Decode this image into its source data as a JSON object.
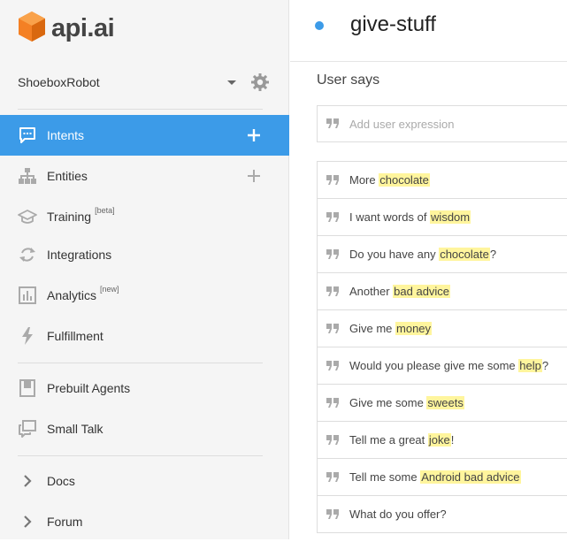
{
  "logo": {
    "text": "api.ai"
  },
  "agent": {
    "name": "ShoeboxRobot"
  },
  "nav": {
    "intents": "Intents",
    "entities": "Entities",
    "training": "Training",
    "training_tag": "[beta]",
    "integrations": "Integrations",
    "analytics": "Analytics",
    "analytics_tag": "[new]",
    "fulfillment": "Fulfillment",
    "prebuilt": "Prebuilt Agents",
    "smalltalk": "Small Talk",
    "docs": "Docs",
    "forum": "Forum"
  },
  "intent": {
    "title": "give-stuff"
  },
  "user_says": {
    "heading": "User says",
    "placeholder": "Add user expression",
    "phrases": [
      {
        "pre": "More ",
        "hl": "chocolate",
        "post": ""
      },
      {
        "pre": "I want words of ",
        "hl": "wisdom",
        "post": ""
      },
      {
        "pre": "Do you have any ",
        "hl": "chocolate",
        "post": "?"
      },
      {
        "pre": "Another ",
        "hl": "bad advice",
        "post": ""
      },
      {
        "pre": "Give me ",
        "hl": "money",
        "post": ""
      },
      {
        "pre": "Would you please give me some ",
        "hl": "help",
        "post": "?"
      },
      {
        "pre": "Give me some ",
        "hl": "sweets",
        "post": ""
      },
      {
        "pre": "Tell me a great ",
        "hl": "joke",
        "post": "!"
      },
      {
        "pre": "Tell me some ",
        "hl": "Android bad advice",
        "post": ""
      },
      {
        "pre": "What do you offer?",
        "hl": "",
        "post": ""
      }
    ]
  },
  "colors": {
    "accent": "#3c9be8",
    "highlight": "#fff59d",
    "logo_orange": "#f48024"
  }
}
